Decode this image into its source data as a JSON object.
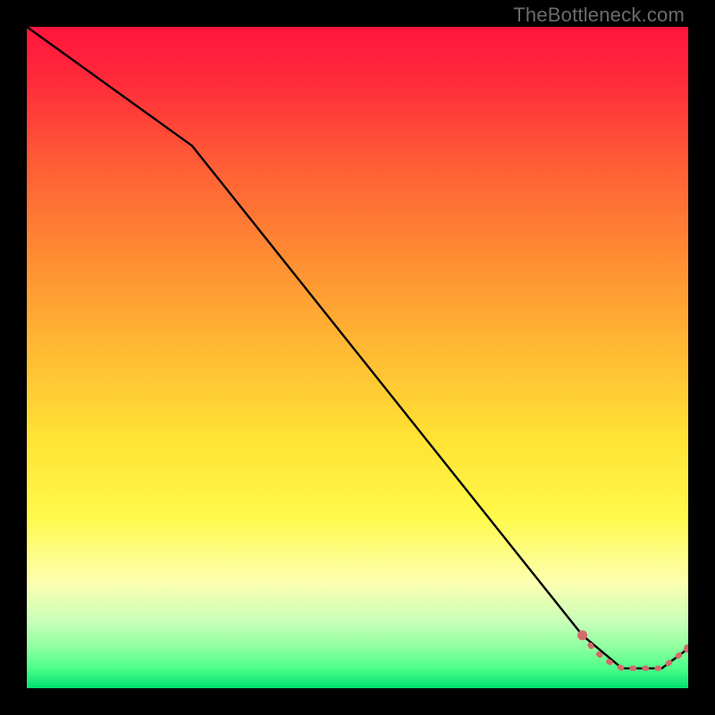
{
  "watermark": "TheBottleneck.com",
  "chart_data": {
    "type": "line",
    "title": "",
    "xlabel": "",
    "ylabel": "",
    "xlim": [
      0,
      100
    ],
    "ylim": [
      0,
      100
    ],
    "grid": false,
    "legend": false,
    "series": [
      {
        "name": "curve",
        "style": "solid-black",
        "points": [
          {
            "x": 0,
            "y": 100
          },
          {
            "x": 25,
            "y": 82
          },
          {
            "x": 84,
            "y": 8
          },
          {
            "x": 90,
            "y": 3
          },
          {
            "x": 96,
            "y": 3
          },
          {
            "x": 100,
            "y": 6
          }
        ]
      },
      {
        "name": "dotted-salmon",
        "style": "dotted-salmon",
        "points": [
          {
            "x": 84,
            "y": 8
          },
          {
            "x": 86,
            "y": 5.5
          },
          {
            "x": 88,
            "y": 4
          },
          {
            "x": 90,
            "y": 3
          },
          {
            "x": 92,
            "y": 3
          },
          {
            "x": 94,
            "y": 3
          },
          {
            "x": 96,
            "y": 3
          },
          {
            "x": 98,
            "y": 4.5
          },
          {
            "x": 100,
            "y": 6
          }
        ]
      }
    ],
    "colors": {
      "curve": "#000000",
      "dotted": "#d46a6a"
    }
  }
}
